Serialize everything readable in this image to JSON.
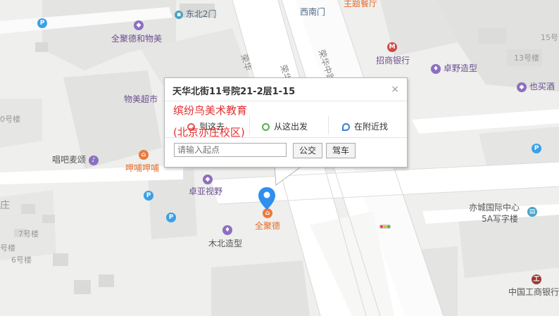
{
  "map": {
    "pois": [
      {
        "label": "东北2门",
        "type": "gate-icon",
        "color": "#4d6a85"
      },
      {
        "label": "西南门",
        "type": "gate-icon",
        "color": "#4d6a85"
      },
      {
        "label": "主题餐厅",
        "type": "restaurant-icon",
        "color": "#e46b2b"
      },
      {
        "label": "全聚德和物美",
        "type": "shopping-icon",
        "color": "#8c6fc1"
      },
      {
        "label": "招商银行",
        "type": "metro-icon",
        "color": "#d14a43"
      },
      {
        "label": "卓野造型",
        "type": "beauty-icon",
        "color": "#8c6fc1"
      },
      {
        "label": "也买酒",
        "type": "shopping-icon",
        "color": "#8c6fc1"
      },
      {
        "label": "物美超市",
        "type": "shopping-icon",
        "color": "#8c6fc1"
      },
      {
        "label": "唱吧麦颂",
        "type": "karaoke-icon",
        "color": "#8c6fc1"
      },
      {
        "label": "呷哺呷哺",
        "type": "restaurant-icon",
        "color": "#e46b2b"
      },
      {
        "label": "卓亚视野",
        "type": "shopping-icon",
        "color": "#8c6fc1"
      },
      {
        "label": "全聚德",
        "type": "restaurant-icon",
        "color": "#e46b2b"
      },
      {
        "label": "木北造型",
        "type": "beauty-icon",
        "color": "#8c6fc1"
      },
      {
        "label": "亦城国际中心 5A写字楼",
        "type": "building-icon",
        "color": "#4aa3c4"
      },
      {
        "label": "中国工商银行",
        "type": "bank-icon",
        "color": "#9b3a35"
      }
    ],
    "building_labels": [
      "15号",
      "13号楼",
      "0号楼",
      "7号楼",
      "号楼",
      "6号楼",
      "庄"
    ],
    "road_labels": [
      "荣华",
      "荣华中路",
      "荣华"
    ]
  },
  "info_window": {
    "title": "天华北街11号院21-2层1-15",
    "close_symbol": "×",
    "overlay_line1": "缤纷鸟美术教育",
    "overlay_line2": "(北京亦庄校区)",
    "action_to": "到这去",
    "action_from": "从这出发",
    "action_nearby": "在附近找",
    "start_placeholder": "请输入起点",
    "bus_label": "公交",
    "drive_label": "驾车"
  },
  "colors": {
    "accent_red": "#e53030",
    "marker_blue": "#2f8ff0",
    "map_bg": "#f1f1ef",
    "road_white": "#ffffff"
  }
}
